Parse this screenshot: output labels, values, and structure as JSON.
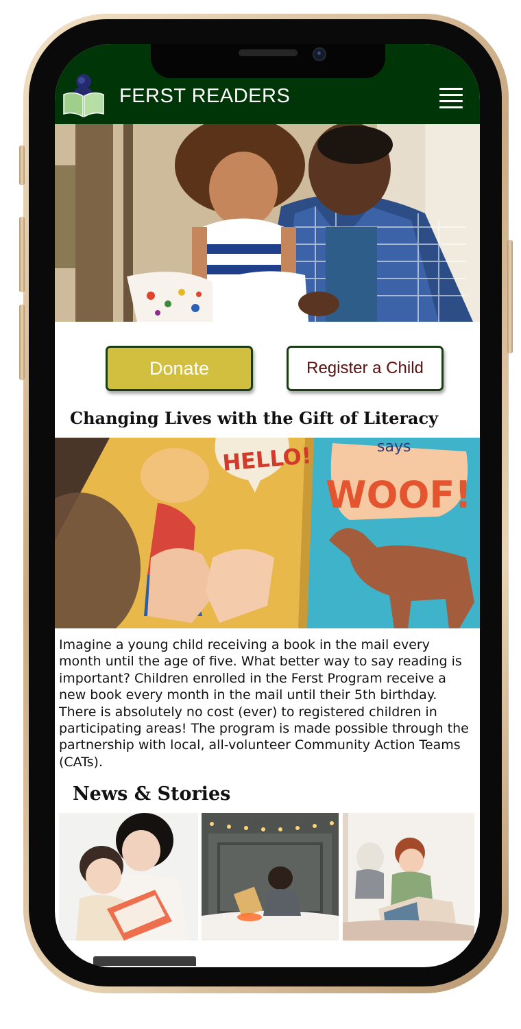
{
  "site": {
    "brand": "FERST READERS",
    "logo_icon": "ferst-readers-book-logo",
    "menu_icon": "hamburger-menu-icon",
    "colors": {
      "header_bg": "#003607",
      "donate_bg": "#d3bf3f",
      "register_text": "#5a0f12",
      "button_border": "#1a3d14"
    }
  },
  "cta": {
    "donate_label": "Donate",
    "register_label": "Register a Child"
  },
  "intro": {
    "title": "Changing Lives with the Gift of Literacy",
    "book_speech_left": "HELLO!",
    "book_speech_right": "WOOF!",
    "book_text_top": "says",
    "body": "Imagine a young child receiving a book in the mail every month until the age of five. What better way to say reading is important? Children enrolled in the Ferst Program receive a new book every month in the mail until their 5th birthday. There is absolutely no cost (ever) to registered children in participating areas! The program is made possible through the partnership with local, all-volunteer Community Action Teams (CATs)."
  },
  "news": {
    "title": "News & Stories"
  }
}
